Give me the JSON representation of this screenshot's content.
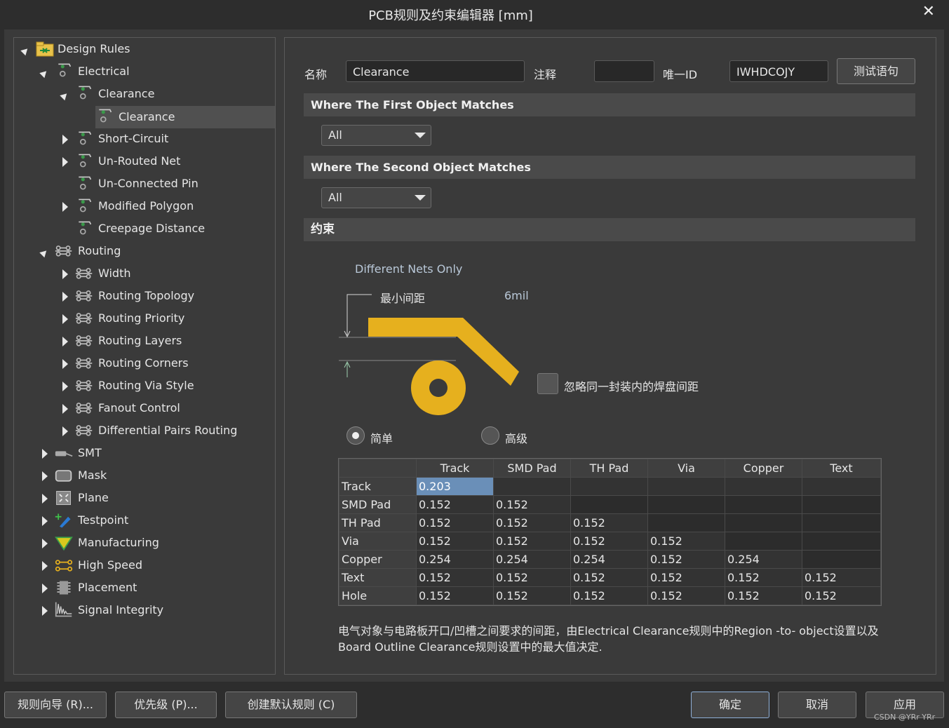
{
  "window": {
    "title": "PCB规则及约束编辑器 [mm]"
  },
  "tree": {
    "root": "Design Rules",
    "items": [
      {
        "label": "Electrical"
      },
      {
        "label": "Clearance"
      },
      {
        "label": "Clearance"
      },
      {
        "label": "Short-Circuit"
      },
      {
        "label": "Un-Routed Net"
      },
      {
        "label": "Un-Connected Pin"
      },
      {
        "label": "Modified Polygon"
      },
      {
        "label": "Creepage Distance"
      },
      {
        "label": "Routing"
      },
      {
        "label": "Width"
      },
      {
        "label": "Routing Topology"
      },
      {
        "label": "Routing Priority"
      },
      {
        "label": "Routing Layers"
      },
      {
        "label": "Routing Corners"
      },
      {
        "label": "Routing Via Style"
      },
      {
        "label": "Fanout Control"
      },
      {
        "label": "Differential Pairs Routing"
      },
      {
        "label": "SMT"
      },
      {
        "label": "Mask"
      },
      {
        "label": "Plane"
      },
      {
        "label": "Testpoint"
      },
      {
        "label": "Manufacturing"
      },
      {
        "label": "High Speed"
      },
      {
        "label": "Placement"
      },
      {
        "label": "Signal Integrity"
      }
    ]
  },
  "form": {
    "name_label": "名称",
    "name_value": "Clearance",
    "comment_label": "注释",
    "comment_value": "",
    "uid_label": "唯一ID",
    "uid_value": "IWHDCOJY",
    "test_button": "测试语句"
  },
  "first_match": {
    "header": "Where The First Object Matches",
    "value": "All"
  },
  "second_match": {
    "header": "Where The Second Object Matches",
    "value": "All"
  },
  "constraints": {
    "header": "约束",
    "nets_mode": "Different Nets Only",
    "min_clearance_label": "最小间距",
    "min_clearance_value": "6mil",
    "ignore_pads_label": "忽略同一封装内的焊盘间距",
    "radio_simple": "简单",
    "radio_advanced": "高级"
  },
  "matrix": {
    "columns": [
      "Track",
      "SMD Pad",
      "TH Pad",
      "Via",
      "Copper",
      "Text"
    ],
    "rows": [
      {
        "name": "Track",
        "values": [
          "0.203",
          "",
          "",
          "",
          "",
          ""
        ]
      },
      {
        "name": "SMD Pad",
        "values": [
          "0.152",
          "0.152"
        ]
      },
      {
        "name": "TH Pad",
        "values": [
          "0.152",
          "0.152",
          "0.152"
        ]
      },
      {
        "name": "Via",
        "values": [
          "0.152",
          "0.152",
          "0.152",
          "0.152"
        ]
      },
      {
        "name": "Copper",
        "values": [
          "0.254",
          "0.254",
          "0.254",
          "0.152",
          "0.254"
        ]
      },
      {
        "name": "Text",
        "values": [
          "0.152",
          "0.152",
          "0.152",
          "0.152",
          "0.152",
          "0.152"
        ]
      },
      {
        "name": "Hole",
        "values": [
          "0.152",
          "0.152",
          "0.152",
          "0.152",
          "0.152",
          "0.152"
        ]
      }
    ]
  },
  "note": "电气对象与电路板开口/凹槽之间要求的间距，由Electrical Clearance规则中的Region -to- object设置以及Board Outline Clearance规则设置中的最大值决定.",
  "footer": {
    "wizard": "规则向导 (R)...",
    "priority": "优先级 (P)...",
    "create_default": "创建默认规则 (C)",
    "ok": "确定",
    "cancel": "取消",
    "apply": "应用",
    "watermark": "CSDN @YRr YRr"
  },
  "colors": {
    "trace": "#e6b01e",
    "accent": "#6a8fb8"
  }
}
